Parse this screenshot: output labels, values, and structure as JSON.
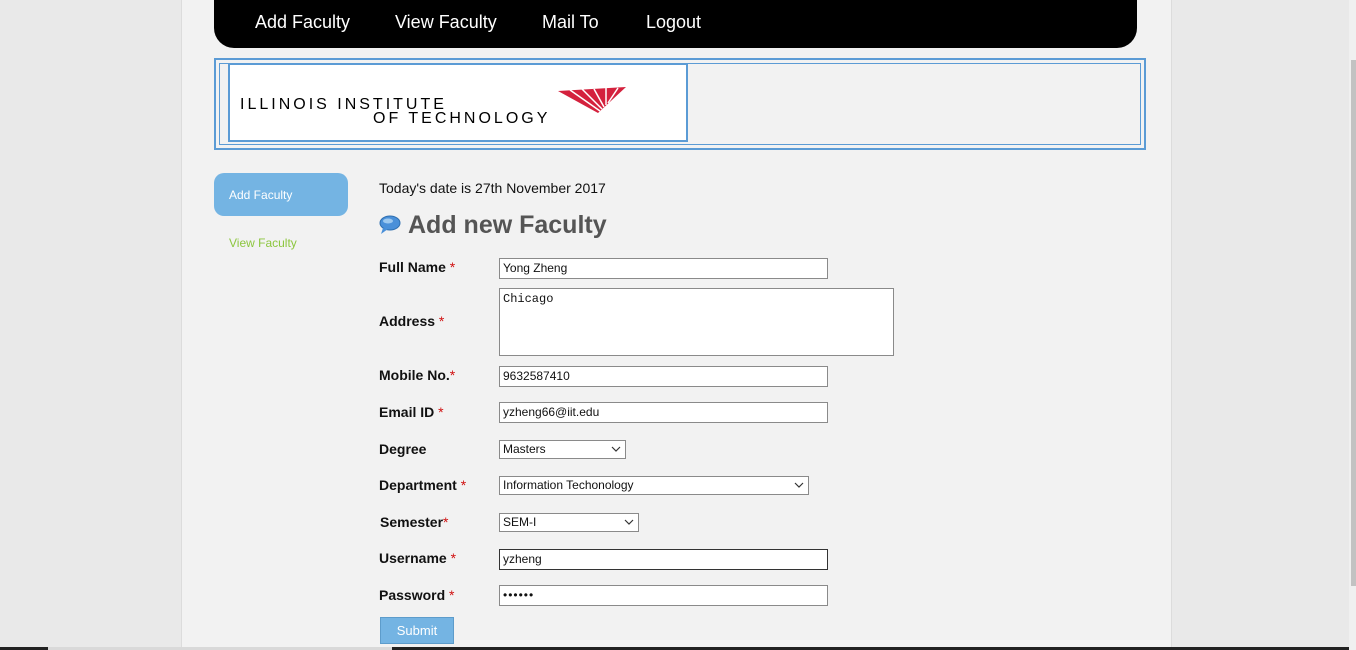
{
  "nav": {
    "items": [
      {
        "label": "Add Faculty"
      },
      {
        "label": "View Faculty"
      },
      {
        "label": "Mail To"
      },
      {
        "label": "Logout"
      }
    ]
  },
  "logo": {
    "line1": "ILLINOIS INSTITUTE",
    "line2": "OF TECHNOLOGY"
  },
  "sidebar": {
    "items": [
      {
        "label": "Add Faculty",
        "active": true
      },
      {
        "label": "View Faculty",
        "active": false
      }
    ]
  },
  "main": {
    "date_text": "Today's date is 27th November 2017",
    "heading": "Add new Faculty",
    "form": {
      "full_name": {
        "label": "Full Name",
        "value": "Yong Zheng"
      },
      "address": {
        "label": "Address",
        "value": "Chicago"
      },
      "mobile": {
        "label": "Mobile No.",
        "value": "9632587410"
      },
      "email": {
        "label": "Email ID",
        "value": "yzheng66@iit.edu"
      },
      "degree": {
        "label": "Degree",
        "value": "Masters"
      },
      "department": {
        "label": "Department",
        "value": "Information Techonology"
      },
      "semester": {
        "label": "Semester",
        "value": "SEM-I"
      },
      "username": {
        "label": "Username",
        "value": "yzheng"
      },
      "password": {
        "label": "Password",
        "value": "••••••"
      },
      "required_mark": "*",
      "submit_label": "Submit"
    }
  },
  "colors": {
    "accent": "#74b4e3",
    "side_link": "#8cc63e",
    "required": "#d01010",
    "logo_red": "#d4213d"
  }
}
